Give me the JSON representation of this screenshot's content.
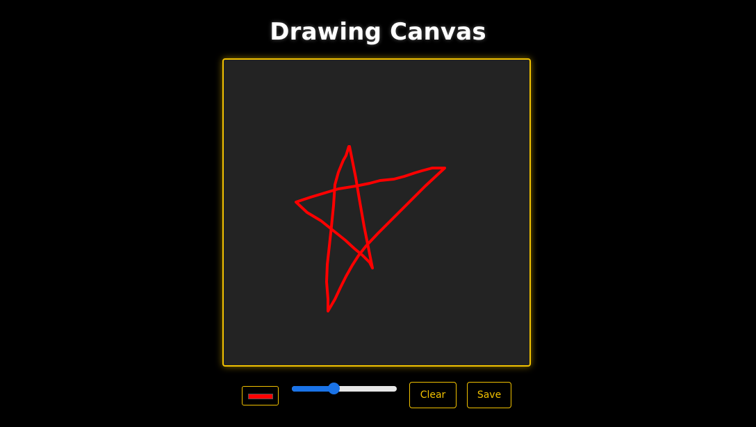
{
  "header": {
    "title": "Drawing Canvas"
  },
  "canvas": {
    "background_color": "#232323",
    "border_color": "#f2c200",
    "stroke": {
      "color": "#ff0000",
      "shape": "hand-drawn star"
    }
  },
  "controls": {
    "color_picker": {
      "value": "#ff0000"
    },
    "brush_size": {
      "fraction": 0.4
    },
    "clear_label": "Clear",
    "save_label": "Save",
    "accent_color": "#f2c200",
    "slider_color": "#1a73e8"
  }
}
